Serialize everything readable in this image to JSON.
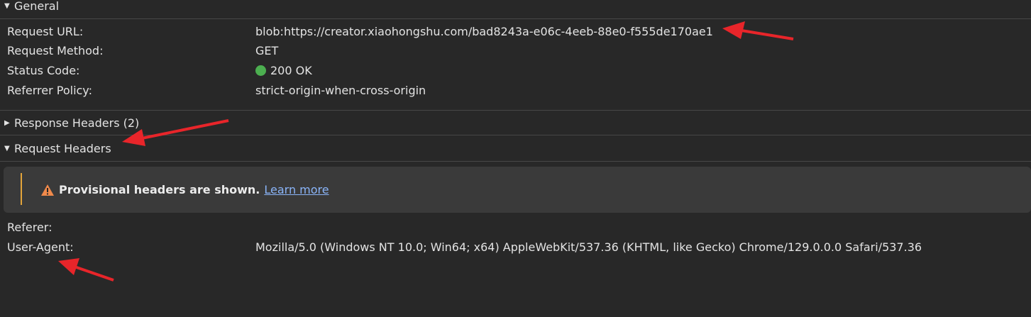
{
  "general": {
    "title": "General",
    "rows": [
      {
        "key": "Request URL:",
        "value": "blob:https://creator.xiaohongshu.com/bad8243a-e06c-4eeb-88e0-f555de170ae1"
      },
      {
        "key": "Request Method:",
        "value": "GET"
      },
      {
        "key": "Status Code:",
        "value": "200 OK",
        "status_color": "#4caf50"
      },
      {
        "key": "Referrer Policy:",
        "value": "strict-origin-when-cross-origin"
      }
    ]
  },
  "response_headers": {
    "title": "Response Headers (2)"
  },
  "request_headers": {
    "title": "Request Headers",
    "warning": {
      "text": "Provisional headers are shown.",
      "link": "Learn more"
    },
    "rows": [
      {
        "key": "Referer:",
        "value": ""
      },
      {
        "key": "User-Agent:",
        "value": "Mozilla/5.0 (Windows NT 10.0; Win64; x64) AppleWebKit/537.36 (KHTML, like Gecko) Chrome/129.0.0.0 Safari/537.36"
      }
    ]
  },
  "colors": {
    "annotation_arrow": "#e8252a",
    "warning_accent": "#e2a43a",
    "link": "#8ab4f8"
  }
}
